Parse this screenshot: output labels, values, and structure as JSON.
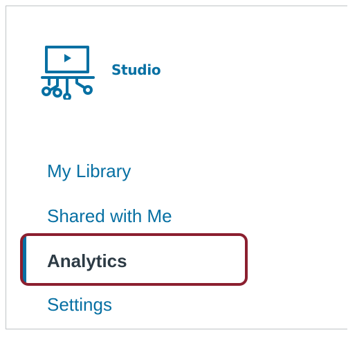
{
  "brand": {
    "name": "Studio",
    "icon": "studio-monitor-icon",
    "color": "#0770a3"
  },
  "nav": {
    "items": [
      {
        "label": "My Library",
        "active": false
      },
      {
        "label": "Shared with Me",
        "active": false
      },
      {
        "label": "Analytics",
        "active": true
      },
      {
        "label": "Settings",
        "active": false
      }
    ]
  },
  "colors": {
    "link": "#0770a3",
    "active_text": "#2d3b45",
    "highlight_border": "#8b1f2f"
  }
}
